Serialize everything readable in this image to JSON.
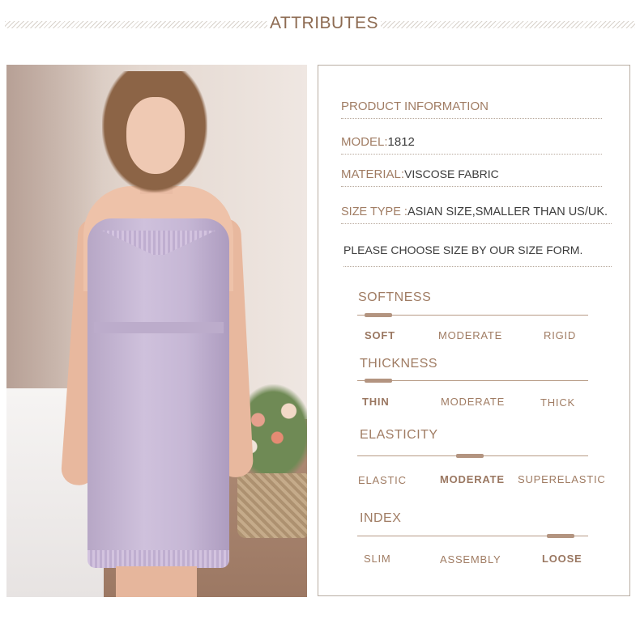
{
  "header": {
    "title": "ATTRIBUTES"
  },
  "photo": {
    "alt": "model wearing lavender slip dress"
  },
  "product_info": {
    "heading": "PRODUCT INFORMATION",
    "model_label": "MODEL:",
    "model_value": "1812",
    "material_label": "MATERIAL:",
    "material_value": "VISCOSE FABRIC",
    "size_type_label": "SIZE TYPE :",
    "size_type_value": "ASIAN SIZE,SMALLER THAN US/UK.",
    "size_note": "PLEASE CHOOSE SIZE BY OUR SIZE FORM."
  },
  "attributes": [
    {
      "title": "SOFTNESS",
      "options": [
        "SOFT",
        "MODERATE",
        "RIGID"
      ],
      "selected_index": 0
    },
    {
      "title": "THICKNESS",
      "options": [
        "THIN",
        "MODERATE",
        "THICK"
      ],
      "selected_index": 0
    },
    {
      "title": "ELASTICITY",
      "options": [
        "ELASTIC",
        "MODERATE",
        "SUPERELASTIC"
      ],
      "selected_index": 1
    },
    {
      "title": "INDEX",
      "options": [
        "SLIM",
        "ASSEMBLY",
        "LOOSE"
      ],
      "selected_index": 2
    }
  ],
  "colors": {
    "accent": "#a07c63",
    "marker": "#b39480",
    "border": "#b9ada3"
  }
}
